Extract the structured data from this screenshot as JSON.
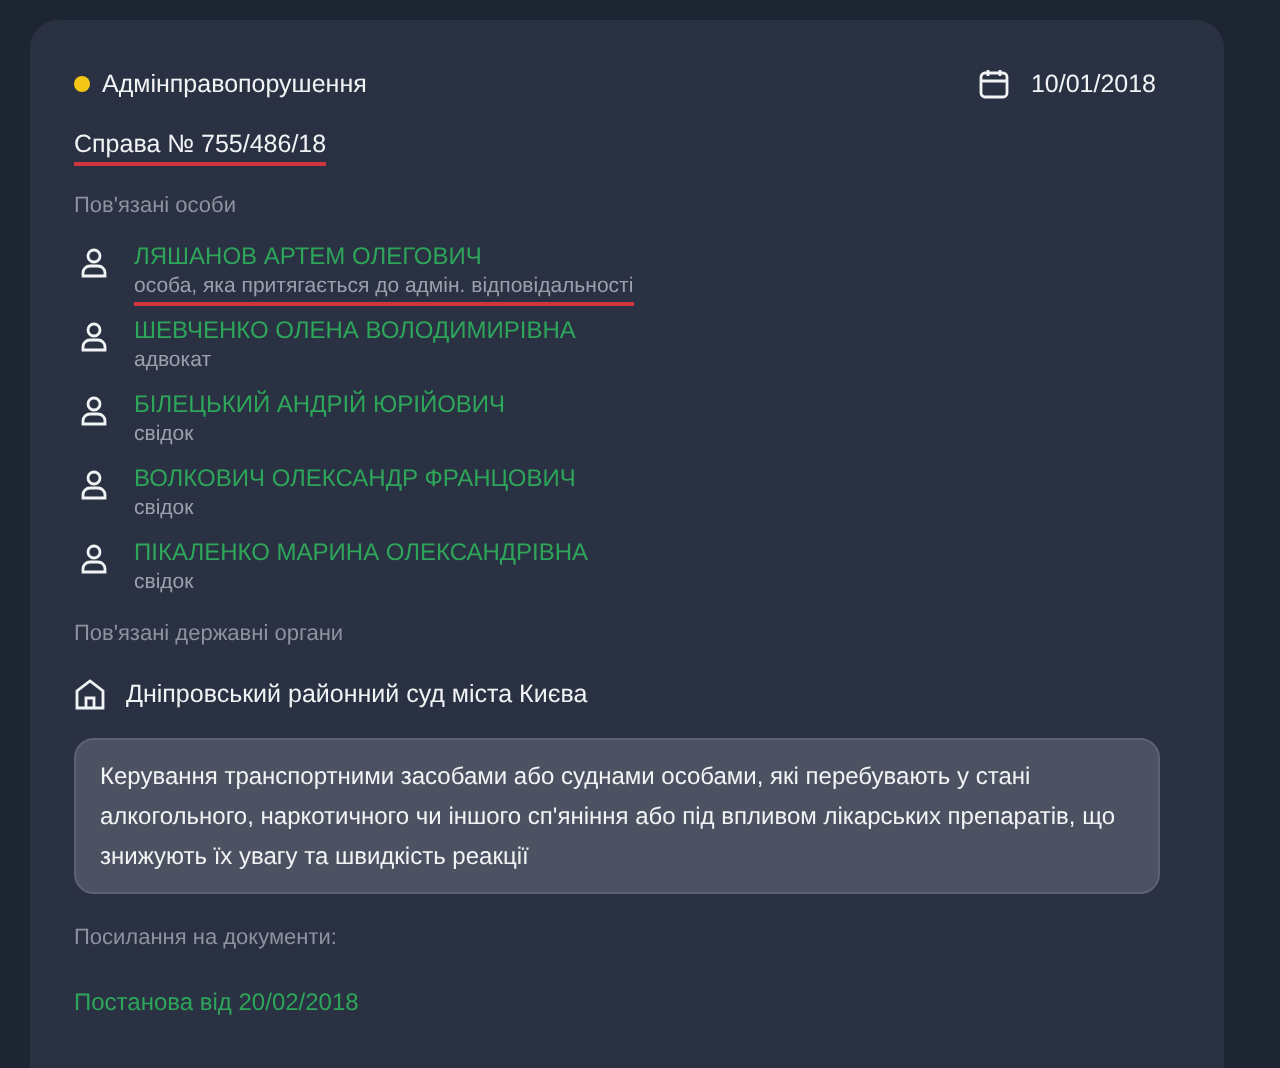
{
  "case": {
    "category": "Адмінправопорушення",
    "color": "#f5c518",
    "date": "10/01/2018",
    "number": "Справа № 755/486/18",
    "number_marked": true
  },
  "persons_section": {
    "title": "Пов'язані особи",
    "persons": [
      {
        "name": "ЛЯШАНОВ АРТЕМ ОЛЕГОВИЧ",
        "role": "особа, яка притягається до адмін. відповідальності",
        "marked": true
      },
      {
        "name": "ШЕВЧЕНКО ОЛЕНА ВОЛОДИМИРІВНА",
        "role": "адвокат",
        "marked": false
      },
      {
        "name": "БІЛЕЦЬКИЙ АНДРІЙ ЮРІЙОВИЧ",
        "role": "свідок",
        "marked": false
      },
      {
        "name": "ВОЛКОВИЧ ОЛЕКСАНДР ФРАНЦОВИЧ",
        "role": "свідок",
        "marked": false
      },
      {
        "name": "ПІКАЛЕНКО МАРИНА ОЛЕКСАНДРІВНА",
        "role": "свідок",
        "marked": false
      }
    ]
  },
  "authorities_section": {
    "title": "Пов'язані державні органи",
    "authorities": [
      "Дніпровський районний суд міста Києва"
    ]
  },
  "description": "Керування транспортними засобами або суднами особами, які перебувають у стані алкогольного, наркотичного чи іншого сп'яніння або під впливом лікарських препаратів, що знижують їх увагу та швидкість реакції",
  "documents_section": {
    "title": "Посилання на документи:",
    "links": [
      "Постанова від 20/02/2018"
    ]
  }
}
